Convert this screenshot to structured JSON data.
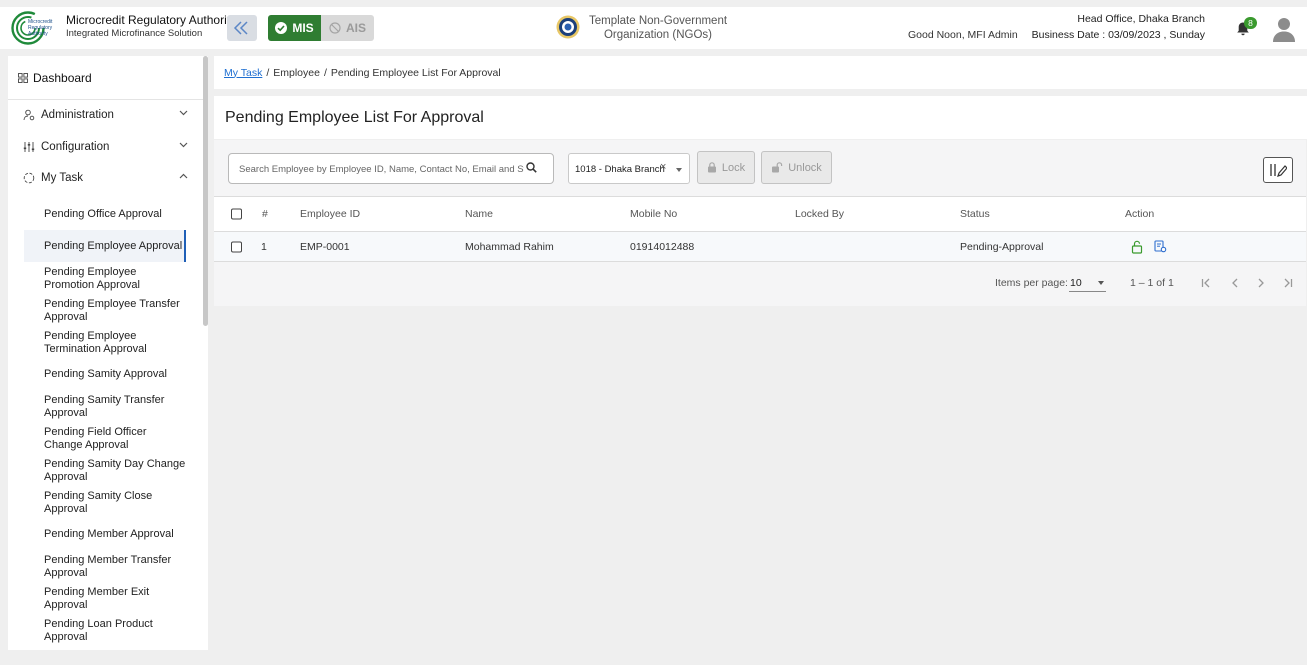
{
  "header": {
    "org_name": "Microcredit Regulatory Authority",
    "org_subtitle": "Integrated Microfinance Solution",
    "logo_text": [
      "Microcredit",
      "Regulatory",
      "Authority"
    ],
    "mode_mis": "MIS",
    "mode_ais": "AIS",
    "ngo_name": "Template Non-Government Organization (NGOs)",
    "greeting": "Good Noon, MFI Admin",
    "branch": "Head Office, Dhaka Branch",
    "business_date": "Business Date : 03/09/2023 , Sunday",
    "notification_count": "8",
    "colors": {
      "mis_active": "#2f7d32",
      "badge": "#3a9a2e",
      "logo": "#1f8a3a"
    }
  },
  "sidebar": {
    "dashboard": "Dashboard",
    "groups": [
      "Administration",
      "Configuration",
      "My Task"
    ],
    "items": [
      "Pending Office Approval",
      "Pending Employee Approval",
      "Pending Employee Promotion Approval",
      "Pending Employee Transfer Approval",
      "Pending Employee Termination Approval",
      "Pending Samity Approval",
      "Pending Samity Transfer Approval",
      "Pending Field Officer Change Approval",
      "Pending Samity Day Change Approval",
      "Pending Samity Close Approval",
      "Pending Member Approval",
      "Pending Member Transfer Approval",
      "Pending Member Exit Approval",
      "Pending Loan Product Approval"
    ],
    "active_index": 1
  },
  "breadcrumb": {
    "link": "My Task",
    "sep": "/",
    "level2": "Employee",
    "current": "Pending Employee List For Approval"
  },
  "page": {
    "title": "Pending Employee List For Approval",
    "search_placeholder": "Search Employee by Employee ID, Name, Contact No, Email and Status",
    "branch_value": "1018 - Dhaka Branch",
    "clear_symbol": "×",
    "lock_label": "Lock",
    "unlock_label": "Unlock"
  },
  "table": {
    "columns": [
      "#",
      "Employee ID",
      "Name",
      "Mobile No",
      "Locked By",
      "Status",
      "Action"
    ],
    "rows": [
      {
        "index": "1",
        "employee_id": "EMP-0001",
        "name": "Mohammad Rahim",
        "mobile": "01914012488",
        "locked_by": "",
        "status": "Pending-Approval"
      }
    ]
  },
  "pager": {
    "items_per_page_label": "Items per page:",
    "items_per_page": "10",
    "range": "1 – 1 of 1"
  }
}
